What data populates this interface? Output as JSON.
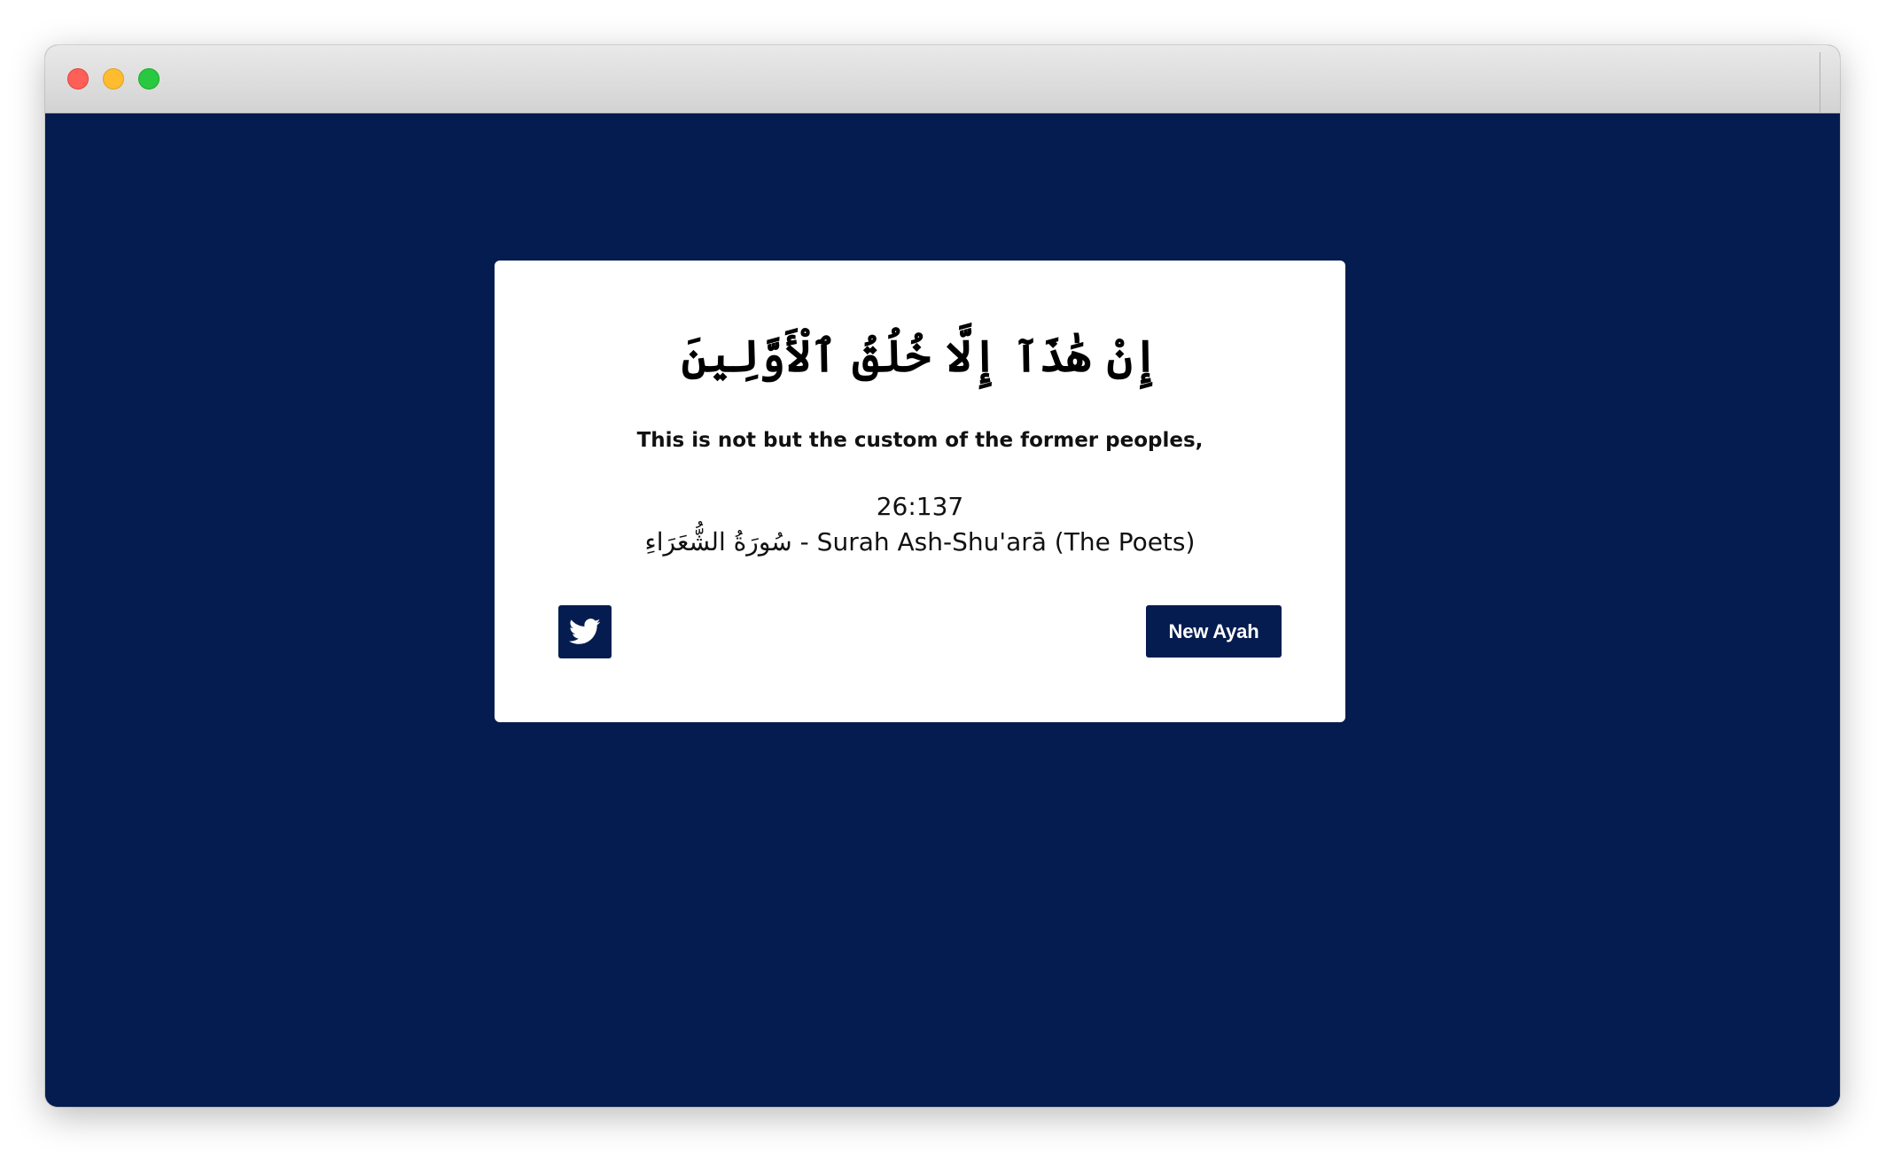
{
  "window": {
    "controls": [
      "close",
      "minimize",
      "maximize"
    ]
  },
  "colors": {
    "background": "#041c4f",
    "card": "#ffffff",
    "button": "#041c4f",
    "button_text": "#ffffff"
  },
  "ayah": {
    "arabic": "إِنْ هَٰذَآ إِلَّا خُلُقُ ٱلْأَوَّلِينَ",
    "translation": "This is not but the custom of the former peoples,",
    "reference": "26:137",
    "surah_arabic": "سُورَةُ الشُّعَرَاءِ",
    "surah_separator": " - ",
    "surah_english": "Surah Ash-Shu'arā (The Poets)"
  },
  "actions": {
    "tweet_icon": "twitter-icon",
    "new_ayah_label": "New Ayah"
  }
}
